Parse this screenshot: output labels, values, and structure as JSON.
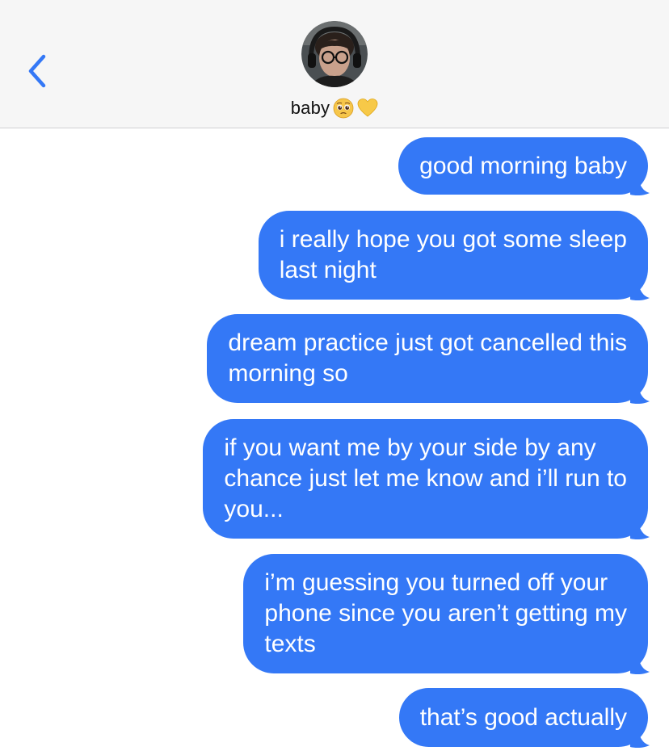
{
  "header": {
    "contact_name": "baby",
    "status_emojis": [
      "pleading-face-emoji",
      "yellow-heart-emoji"
    ],
    "back_icon": "chevron-left-icon"
  },
  "colors": {
    "header_bg": "#f6f6f6",
    "sent_bubble": "#3478f6",
    "back_chevron": "#3478f6",
    "text_on_bubble": "#ffffff"
  },
  "messages": [
    {
      "direction": "sent",
      "text": "good morning baby"
    },
    {
      "direction": "sent",
      "text": "i really hope you got some sleep\nlast night"
    },
    {
      "direction": "sent",
      "text": "dream practice just got cancelled this\nmorning so"
    },
    {
      "direction": "sent",
      "text": "if you want me by your side by any\nchance just let me know and i’ll run to\nyou..."
    },
    {
      "direction": "sent",
      "text": "i’m guessing you turned off your\nphone since you aren’t getting my\ntexts"
    },
    {
      "direction": "sent",
      "text": "that’s good actually"
    }
  ]
}
